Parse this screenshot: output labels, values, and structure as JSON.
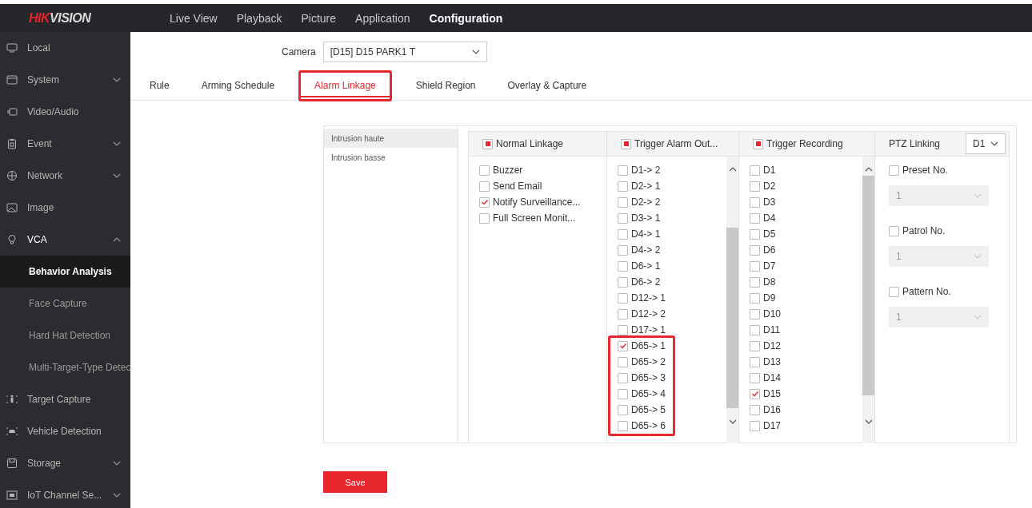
{
  "topbar": {
    "logo_parts": [
      "HIK",
      "VISION"
    ],
    "menu": [
      {
        "label": "Live View",
        "selected": false
      },
      {
        "label": "Playback",
        "selected": false
      },
      {
        "label": "Picture",
        "selected": false
      },
      {
        "label": "Application",
        "selected": false
      },
      {
        "label": "Configuration",
        "selected": true
      }
    ]
  },
  "sidebar": {
    "items": [
      {
        "label": "Local",
        "kind": "link"
      },
      {
        "label": "System",
        "kind": "group",
        "expanded": false
      },
      {
        "label": "Video/Audio",
        "kind": "link"
      },
      {
        "label": "Event",
        "kind": "group",
        "expanded": false
      },
      {
        "label": "Network",
        "kind": "group",
        "expanded": false
      },
      {
        "label": "Image",
        "kind": "link"
      },
      {
        "label": "VCA",
        "kind": "group",
        "expanded": true,
        "children": [
          {
            "label": "Behavior Analysis",
            "selected": true
          },
          {
            "label": "Face Capture",
            "selected": false
          },
          {
            "label": "Hard Hat Detection",
            "selected": false
          },
          {
            "label": "Multi-Target-Type Detec",
            "selected": false
          }
        ]
      },
      {
        "label": "Target Capture",
        "kind": "link"
      },
      {
        "label": "Vehicle Detection",
        "kind": "link"
      },
      {
        "label": "Storage",
        "kind": "group",
        "expanded": false
      },
      {
        "label": "IoT Channel Se...",
        "kind": "group",
        "expanded": false
      }
    ]
  },
  "camera": {
    "label": "Camera",
    "value": "[D15] D15 PARK1 T"
  },
  "tabs": [
    {
      "label": "Rule",
      "selected": false,
      "highlighted": false
    },
    {
      "label": "Arming Schedule",
      "selected": false,
      "highlighted": false
    },
    {
      "label": "Alarm Linkage",
      "selected": true,
      "highlighted": true
    },
    {
      "label": "Shield Region",
      "selected": false,
      "highlighted": false
    },
    {
      "label": "Overlay & Capture",
      "selected": false,
      "highlighted": false
    }
  ],
  "event_list": [
    {
      "label": "Intrusion haute",
      "selected": true
    },
    {
      "label": "Intrusion basse",
      "selected": false
    }
  ],
  "linkage": {
    "normal": {
      "title": "Normal Linkage",
      "checked": true,
      "items": [
        {
          "label": "Buzzer",
          "checked": false
        },
        {
          "label": "Send Email",
          "checked": false
        },
        {
          "label": "Notify Surveillance...",
          "checked": true
        },
        {
          "label": "Full Screen Monit...",
          "checked": false
        }
      ]
    },
    "alarm_output": {
      "title": "Trigger Alarm Out...",
      "checked": true,
      "items": [
        {
          "label": "D1-> 2",
          "checked": false
        },
        {
          "label": "D2-> 1",
          "checked": false
        },
        {
          "label": "D2-> 2",
          "checked": false
        },
        {
          "label": "D3-> 1",
          "checked": false
        },
        {
          "label": "D4-> 1",
          "checked": false
        },
        {
          "label": "D4-> 2",
          "checked": false
        },
        {
          "label": "D6-> 1",
          "checked": false
        },
        {
          "label": "D6-> 2",
          "checked": false
        },
        {
          "label": "D12-> 1",
          "checked": false
        },
        {
          "label": "D12-> 2",
          "checked": false
        },
        {
          "label": "D17-> 1",
          "checked": false
        }
      ],
      "highlighted_items": [
        {
          "label": "D65-> 1",
          "checked": true
        },
        {
          "label": "D65-> 2",
          "checked": false
        },
        {
          "label": "D65-> 3",
          "checked": false
        },
        {
          "label": "D65-> 4",
          "checked": false
        },
        {
          "label": "D65-> 5",
          "checked": false
        },
        {
          "label": "D65-> 6",
          "checked": false
        }
      ]
    },
    "recording": {
      "title": "Trigger Recording",
      "checked": true,
      "items": [
        {
          "label": "D1",
          "checked": false
        },
        {
          "label": "D2",
          "checked": false
        },
        {
          "label": "D3",
          "checked": false
        },
        {
          "label": "D4",
          "checked": false
        },
        {
          "label": "D5",
          "checked": false
        },
        {
          "label": "D6",
          "checked": false
        },
        {
          "label": "D7",
          "checked": false
        },
        {
          "label": "D8",
          "checked": false
        },
        {
          "label": "D9",
          "checked": false
        },
        {
          "label": "D10",
          "checked": false
        },
        {
          "label": "D11",
          "checked": false
        },
        {
          "label": "D12",
          "checked": false
        },
        {
          "label": "D13",
          "checked": false
        },
        {
          "label": "D14",
          "checked": false
        },
        {
          "label": "D15",
          "checked": true
        },
        {
          "label": "D16",
          "checked": false
        },
        {
          "label": "D17",
          "checked": false
        }
      ]
    },
    "ptz": {
      "title": "PTZ Linking",
      "channel": "D1",
      "options": [
        {
          "label": "Preset No.",
          "checked": false,
          "value": "1",
          "disabled": true
        },
        {
          "label": "Patrol No.",
          "checked": false,
          "value": "1",
          "disabled": true
        },
        {
          "label": "Pattern No.",
          "checked": false,
          "value": "1",
          "disabled": true
        }
      ]
    }
  },
  "save_button": "Save"
}
